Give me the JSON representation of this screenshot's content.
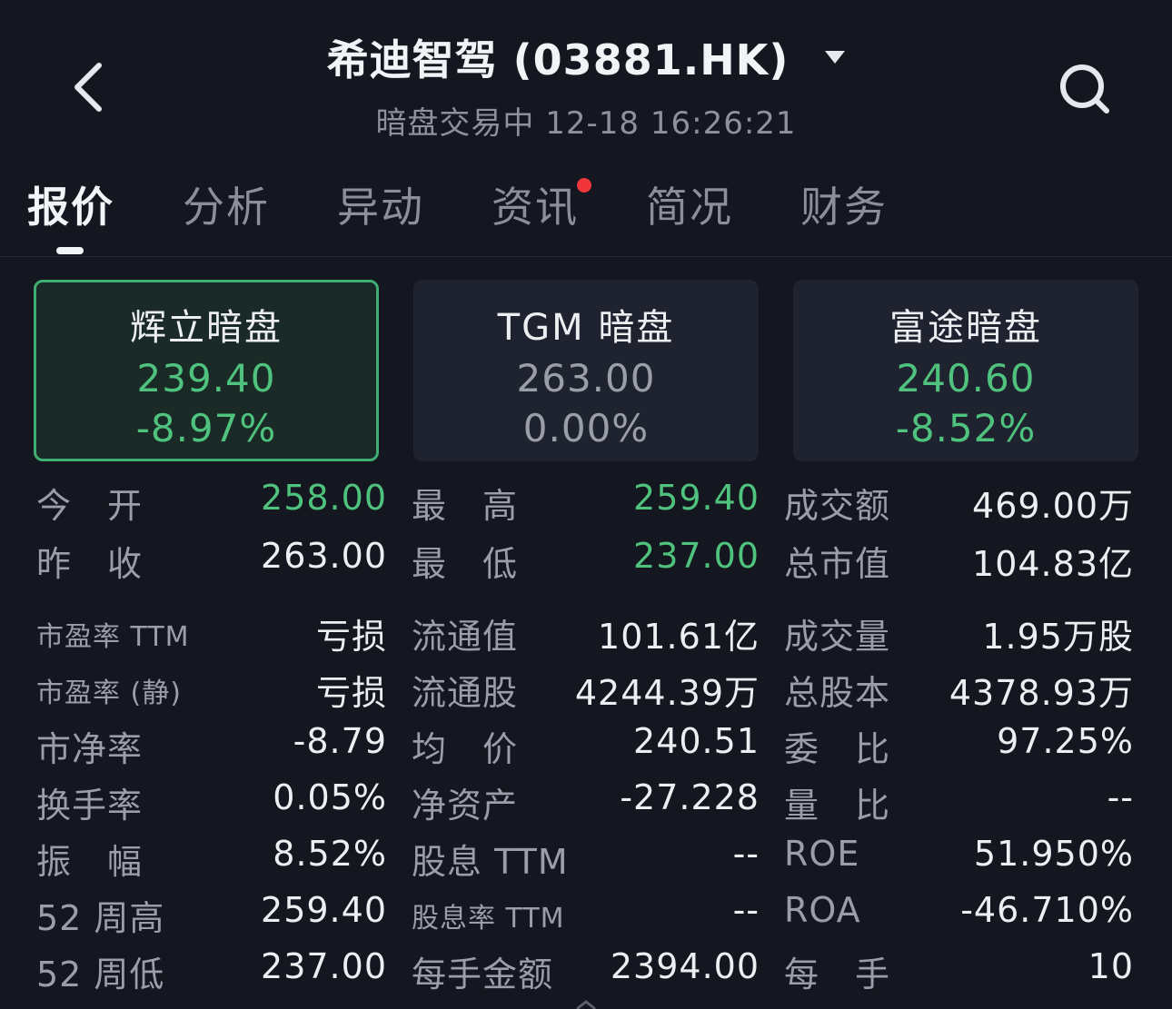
{
  "header": {
    "title": "希迪智驾 (03881.HK)",
    "subtitle": "暗盘交易中 12-18 16:26:21"
  },
  "tabs": [
    {
      "label": "报价",
      "active": true
    },
    {
      "label": "分析",
      "active": false
    },
    {
      "label": "异动",
      "active": false
    },
    {
      "label": "资讯",
      "active": false,
      "badge": true
    },
    {
      "label": "简况",
      "active": false
    },
    {
      "label": "财务",
      "active": false
    }
  ],
  "dark_pools": [
    {
      "name": "辉立暗盘",
      "price": "239.40",
      "change_pct": "-8.97%",
      "selected": true,
      "tone": "down"
    },
    {
      "name": "TGM 暗盘",
      "price": "263.00",
      "change_pct": "0.00%",
      "selected": false,
      "tone": "flat"
    },
    {
      "name": "富途暗盘",
      "price": "240.60",
      "change_pct": "-8.52%",
      "selected": false,
      "tone": "down"
    }
  ],
  "stats": [
    [
      {
        "label": "今　开",
        "value": "258.00",
        "tone": "down"
      },
      {
        "label": "最　高",
        "value": "259.40",
        "tone": "down"
      },
      {
        "label": "成交额",
        "value": "469.00万",
        "tone": "normal"
      }
    ],
    [
      {
        "label": "昨　收",
        "value": "263.00",
        "tone": "normal"
      },
      {
        "label": "最　低",
        "value": "237.00",
        "tone": "down"
      },
      {
        "label": "总市值",
        "value": "104.83亿",
        "tone": "normal"
      }
    ],
    [
      {
        "label": "市盈率 TTM",
        "value": "亏损",
        "tone": "normal",
        "small": true
      },
      {
        "label": "流通值",
        "value": "101.61亿",
        "tone": "normal"
      },
      {
        "label": "成交量",
        "value": "1.95万股",
        "tone": "normal"
      }
    ],
    [
      {
        "label": "市盈率 (静)",
        "value": "亏损",
        "tone": "normal",
        "small": true
      },
      {
        "label": "流通股",
        "value": "4244.39万",
        "tone": "normal"
      },
      {
        "label": "总股本",
        "value": "4378.93万",
        "tone": "normal"
      }
    ],
    [
      {
        "label": "市净率",
        "value": "-8.79",
        "tone": "normal"
      },
      {
        "label": "均　价",
        "value": "240.51",
        "tone": "normal"
      },
      {
        "label": "委　比",
        "value": "97.25%",
        "tone": "normal"
      }
    ],
    [
      {
        "label": "换手率",
        "value": "0.05%",
        "tone": "normal"
      },
      {
        "label": "净资产",
        "value": "-27.228",
        "tone": "normal"
      },
      {
        "label": "量　比",
        "value": "--",
        "tone": "normal"
      }
    ],
    [
      {
        "label": "振　幅",
        "value": "8.52%",
        "tone": "normal"
      },
      {
        "label": "股息 TTM",
        "value": "--",
        "tone": "normal"
      },
      {
        "label": "ROE",
        "value": "51.950%",
        "tone": "normal"
      }
    ],
    [
      {
        "label": "52 周高",
        "value": "259.40",
        "tone": "normal"
      },
      {
        "label": "股息率 TTM",
        "value": "--",
        "tone": "normal",
        "small": true
      },
      {
        "label": "ROA",
        "value": "-46.710%",
        "tone": "normal"
      }
    ],
    [
      {
        "label": "52 周低",
        "value": "237.00",
        "tone": "normal"
      },
      {
        "label": "每手金额",
        "value": "2394.00",
        "tone": "normal"
      },
      {
        "label": "每　手",
        "value": "10",
        "tone": "normal"
      }
    ]
  ],
  "icons": {
    "back": "chevron-left-icon",
    "search": "search-icon",
    "dropdown": "caret-down-icon"
  },
  "colors": {
    "background": "#14171f",
    "down": "#4fc27d",
    "text": "#eceef2",
    "muted": "#9a9ea8",
    "badge": "#f0353b"
  }
}
